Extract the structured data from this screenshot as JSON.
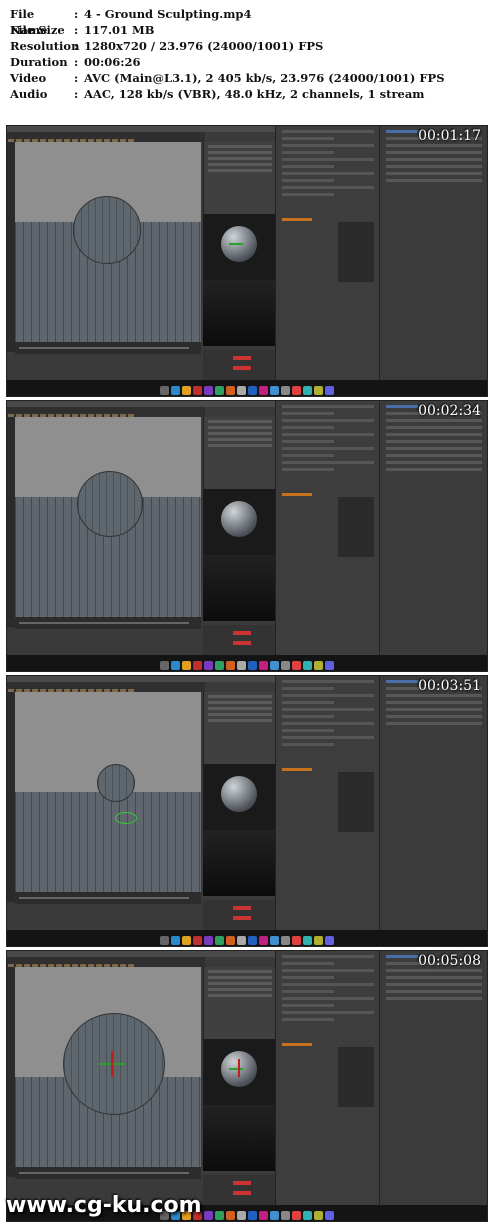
{
  "info": {
    "rows": [
      {
        "label": "File Name",
        "value": "4 - Ground Sculpting.mp4"
      },
      {
        "label": "File Size",
        "value": "117.01 MB"
      },
      {
        "label": "Resolution",
        "value": "1280x720 / 23.976 (24000/1001) FPS"
      },
      {
        "label": "Duration",
        "value": "00:06:26"
      },
      {
        "label": "Video",
        "value": "AVC (Main@L3.1), 2 405 kb/s, 23.976 (24000/1001) FPS"
      },
      {
        "label": "Audio",
        "value": "AAC, 128 kb/s (VBR), 48.0 kHz, 2 channels, 1 stream"
      }
    ],
    "separator": ":"
  },
  "frames": [
    {
      "timestamp": "00:01:17"
    },
    {
      "timestamp": "00:02:34"
    },
    {
      "timestamp": "00:03:51"
    },
    {
      "timestamp": "00:05:08"
    }
  ],
  "watermark": "www.cg-ku.com",
  "colors": {
    "ui_background": "#3a3a3a",
    "viewport": "#8f8f8f",
    "accent_orange": "#c7721e",
    "selection_blue": "#4a6fa8",
    "taskbar": "#141414"
  }
}
